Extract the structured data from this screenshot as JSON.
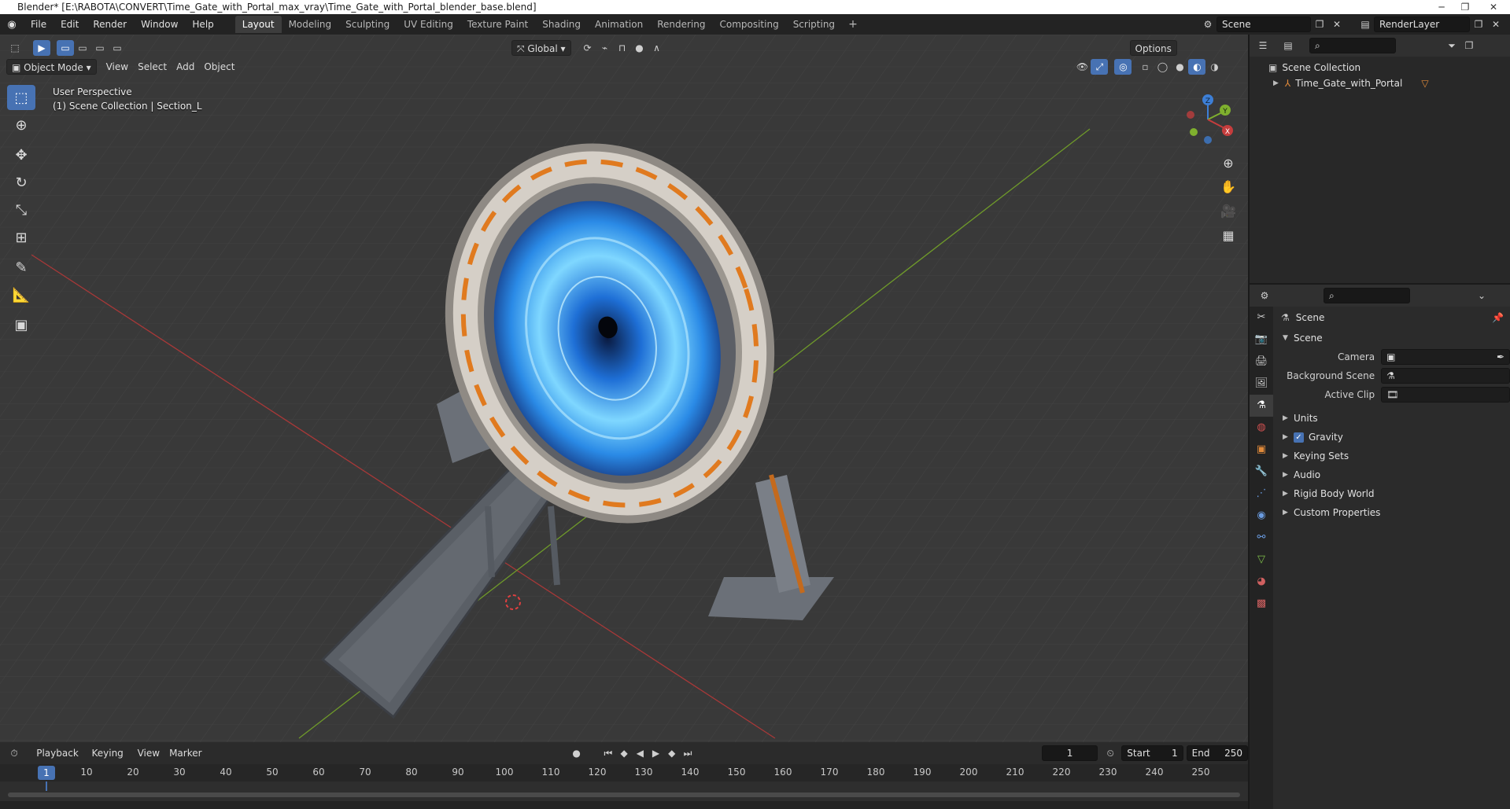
{
  "window": {
    "title": "Blender* [E:\\RABOTA\\CONVERT\\Time_Gate_with_Portal_max_vray\\Time_Gate_with_Portal_blender_base.blend]"
  },
  "menu": {
    "items": [
      "File",
      "Edit",
      "Render",
      "Window",
      "Help"
    ],
    "workspaces": [
      "Layout",
      "Modeling",
      "Sculpting",
      "UV Editing",
      "Texture Paint",
      "Shading",
      "Animation",
      "Rendering",
      "Compositing",
      "Scripting"
    ],
    "active_workspace": "Layout",
    "scene": "Scene",
    "view_layer": "RenderLayer"
  },
  "viewport": {
    "mode": "Object Mode",
    "menus": [
      "View",
      "Select",
      "Add",
      "Object"
    ],
    "orientation": "Global",
    "options_label": "Options",
    "overlay_line1": "User Perspective",
    "overlay_line2": "(1) Scene Collection | Section_L",
    "gizmo_axes": {
      "x": "X",
      "y": "Y",
      "z": "Z"
    },
    "colors": {
      "x_axis": "#c53d3d",
      "y_axis": "#7fb02e",
      "z_axis": "#3d7fd6",
      "accent": "#4772b3"
    }
  },
  "timeline": {
    "menus": [
      "Playback",
      "Keying",
      "View",
      "Marker"
    ],
    "current_frame": "1",
    "start_label": "Start",
    "start": "1",
    "end_label": "End",
    "end": "250",
    "ticks": [
      "10",
      "20",
      "30",
      "40",
      "50",
      "60",
      "70",
      "80",
      "90",
      "100",
      "110",
      "120",
      "130",
      "140",
      "150",
      "160",
      "170",
      "180",
      "190",
      "200",
      "210",
      "220",
      "230",
      "240",
      "250"
    ]
  },
  "outliner": {
    "root": "Scene Collection",
    "items": [
      {
        "name": "Time_Gate_with_Portal"
      }
    ]
  },
  "properties": {
    "context": "Scene",
    "panel_title": "Scene",
    "fields": [
      {
        "label": "Camera",
        "value": ""
      },
      {
        "label": "Background Scene",
        "value": ""
      },
      {
        "label": "Active Clip",
        "value": ""
      }
    ],
    "sections": [
      "Units",
      "Gravity",
      "Keying Sets",
      "Audio",
      "Rigid Body World",
      "Custom Properties"
    ],
    "gravity_checked": true
  }
}
